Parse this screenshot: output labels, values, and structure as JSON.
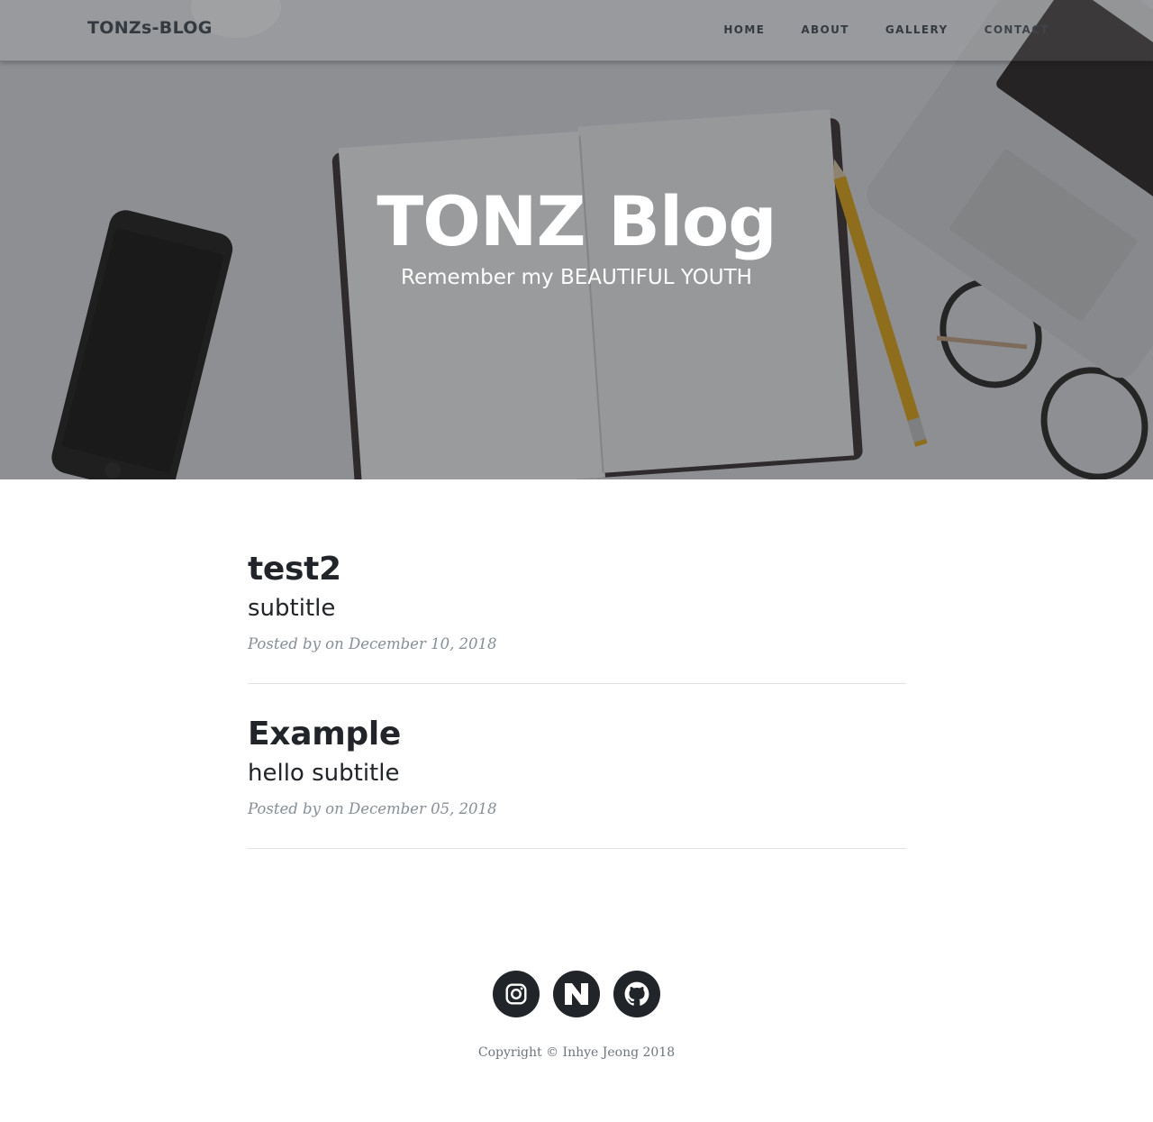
{
  "navbar": {
    "brand": "TONZs-BLOG",
    "links": [
      {
        "label": "HOME"
      },
      {
        "label": "ABOUT"
      },
      {
        "label": "GALLERY"
      },
      {
        "label": "CONTACT"
      }
    ]
  },
  "hero": {
    "title": "TONZ Blog",
    "subtitle": "Remember my BEAUTIFUL YOUTH"
  },
  "posts": [
    {
      "title": "test2",
      "subtitle": "subtitle",
      "meta": "Posted by on December 10, 2018"
    },
    {
      "title": "Example",
      "subtitle": "hello subtitle",
      "meta": "Posted by on December 05, 2018"
    }
  ],
  "footer": {
    "socials": [
      {
        "icon": "instagram-icon"
      },
      {
        "icon": "naver-icon"
      },
      {
        "icon": "github-icon"
      }
    ],
    "copyright": "Copyright © Inhye Jeong 2018"
  }
}
